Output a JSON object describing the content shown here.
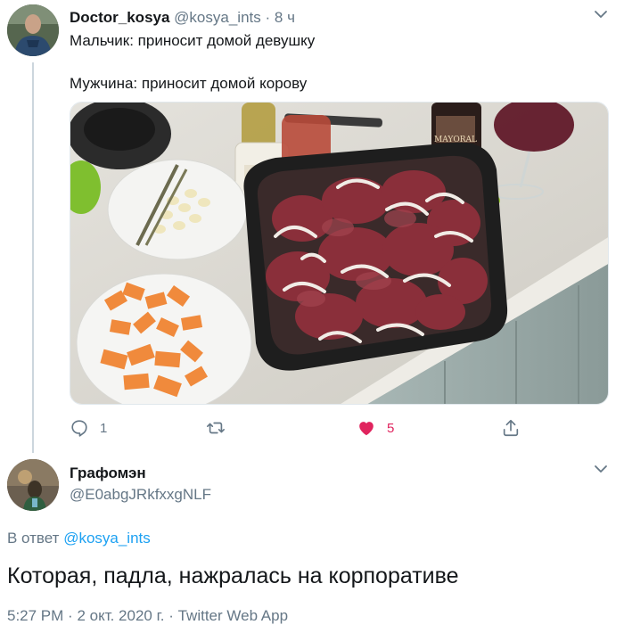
{
  "tweet1": {
    "author_name": "Doctor_kosya",
    "author_handle": "@kosya_ints",
    "separator": "·",
    "time": "8 ч",
    "text_line1": "Мальчик: приносит домой девушку",
    "text_line2": "Мужчина: приносит домой корову",
    "actions": {
      "reply_count": "1",
      "retweet_count": "",
      "like_count": "5",
      "like_color": "#e0245e"
    }
  },
  "tweet2": {
    "author_name": "Графомэн",
    "author_handle": "@E0abgJRkfxxgNLF",
    "reply_prefix": "В ответ",
    "reply_to": "@kosya_ints",
    "text": "Которая, падла, нажралась на корпоративе",
    "time": "5:27 PM",
    "sep1": "·",
    "date": "2 окт. 2020 г.",
    "sep2": "·",
    "source": "Twitter Web App"
  },
  "colors": {
    "secondary_text": "#657786",
    "link": "#1da1f2",
    "thread_line": "#ccd6dd"
  },
  "icons": [
    "chevron-down-icon",
    "reply-icon",
    "retweet-icon",
    "heart-icon",
    "share-icon"
  ],
  "photo": {
    "wine_label": "MAYORAL"
  }
}
